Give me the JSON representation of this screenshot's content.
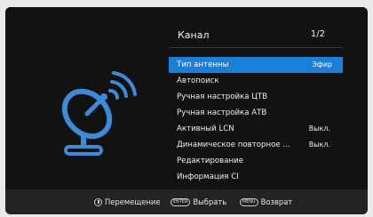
{
  "header": {
    "title": "Канал",
    "page": "1/2"
  },
  "menu": {
    "items": [
      {
        "label": "Тип антенны",
        "value": "Эфир"
      },
      {
        "label": "Автопоиск",
        "value": ""
      },
      {
        "label": "Ручная настройка ЦТВ",
        "value": ""
      },
      {
        "label": "Ручная настройка АТВ",
        "value": ""
      },
      {
        "label": "Активный LCN",
        "value": "Выкл."
      },
      {
        "label": "Динамическое повторное ...",
        "value": "Выкл."
      },
      {
        "label": "Редактирование",
        "value": ""
      },
      {
        "label": "Информация CI",
        "value": ""
      }
    ]
  },
  "footer": {
    "move_label": "Перемещение",
    "enter_key": "ENTER",
    "select_label": "Выбрать",
    "menu_key": "MENU",
    "back_label": "Возврат"
  },
  "colors": {
    "highlight": "#1a7fd6",
    "icon": "#3f8ad8"
  },
  "icons": {
    "illustration": "satellite-dish-icon"
  }
}
